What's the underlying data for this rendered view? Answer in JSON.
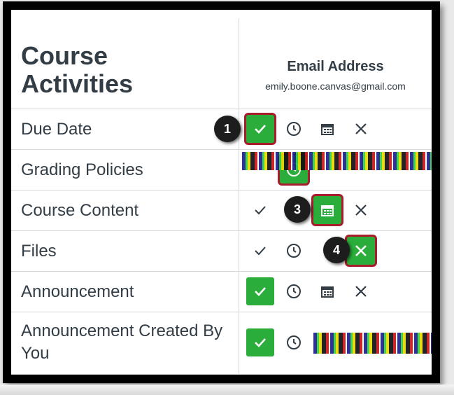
{
  "title": "Course Activities",
  "column_header": "Email Address",
  "email": "emily.boone.canvas@gmail.com",
  "rows": [
    {
      "label": "Due Date",
      "selected": "check"
    },
    {
      "label": "Grading Policies",
      "selected": "clock"
    },
    {
      "label": "Course Content",
      "selected": "calendar"
    },
    {
      "label": "Files",
      "selected": "close"
    },
    {
      "label": "Announcement",
      "selected": "check"
    },
    {
      "label": "Announcement Created By You",
      "selected": "check"
    }
  ],
  "options": [
    "check-icon",
    "clock-icon",
    "calendar-icon",
    "close-icon"
  ],
  "callouts": [
    "1",
    "3",
    "4"
  ],
  "colors": {
    "selected": "#2bad3c",
    "highlight": "#a81c2c",
    "text": "#333d46"
  }
}
